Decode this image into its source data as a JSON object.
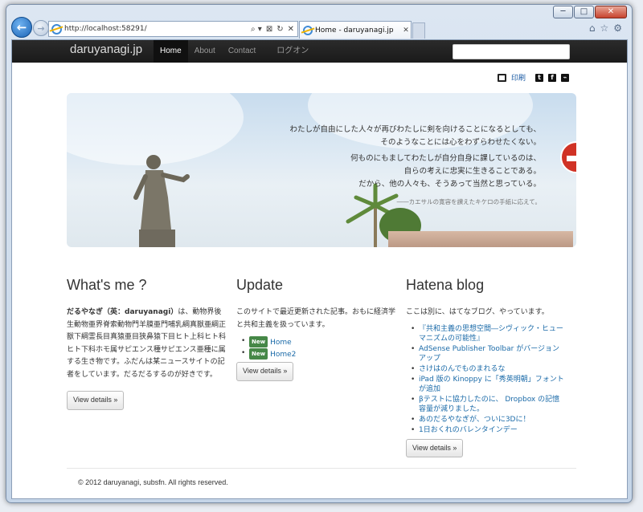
{
  "browser": {
    "address": "http://localhost:58291/",
    "tab_title": "Home - daruyanagi.jp",
    "window_buttons": {
      "minimize": "─",
      "maximize": "□",
      "close": "✕"
    },
    "address_tools": [
      "⌕ ▾",
      "⊠",
      "↻",
      "✕"
    ],
    "right_tools": [
      "⌂",
      "☆",
      "⚙"
    ]
  },
  "navbar": {
    "brand": "daruyanagi.jp",
    "links": [
      {
        "label": "Home",
        "active": true
      },
      {
        "label": "About",
        "active": false
      },
      {
        "label": "Contact",
        "active": false
      },
      {
        "label": "ログオン",
        "active": false
      }
    ],
    "search_placeholder": ""
  },
  "share": {
    "print_label": "印刷",
    "icons": [
      "twitter-icon",
      "facebook-icon",
      "rss-icon"
    ],
    "icon_glyphs": [
      "t",
      "f",
      "⌁"
    ]
  },
  "hero": {
    "quote_lines_1": [
      "わたしが自由にした人々が再びわたしに剣を向けることになるとしても、",
      "そのようなことには心をわずらわせたくない。"
    ],
    "quote_lines_2": [
      "何ものにもましてわたしが自分自身に課しているのは、",
      "自らの考えに忠実に生きることである。",
      "だから、他の人々も、そうあって当然と思っている。"
    ],
    "attribution": "――カエサルの寛容を讃えたキケロの手紙に応えて。"
  },
  "columns": {
    "whats_me": {
      "title": "What's me ?",
      "body_bold": "だるやなぎ（英：daruyanagi）",
      "body": "は、動物界後生動物亜界脊索動物門羊膜亜門哺乳綱真獣亜綱正獣下綱霊長目真猿亜目狭鼻猿下目ヒト上科ヒト科ヒト下科ホモ属サピエンス種サピエンス亜種に属する生き物です。ふだんは某ニュースサイトの記者をしています。だるだるするのが好きです。",
      "button": "View details »"
    },
    "update": {
      "title": "Update",
      "body": "このサイトで最近更新された記事。おもに経済学と共和主義を扱っています。",
      "badge": "New",
      "items": [
        "Home",
        "Home2"
      ],
      "button": "View details »"
    },
    "hatena": {
      "title": "Hatena blog",
      "body": "ここは別に、はてなブログ、やっています。",
      "items": [
        "『共和主義の思想空間―シヴィック・ヒューマニズムの可能性』",
        "AdSense Publisher Toolbar がバージョンアップ",
        "さけはのんでものまれるな",
        "iPad 版の Kinoppy に「秀英明朝」フォントが追加",
        "βテストに協力したのに、 Dropbox の記憶容量が減りました。",
        "あのだるやなぎが、ついに3Dに！",
        "1日おくれのバレンタインデー"
      ],
      "button": "View details »"
    }
  },
  "footer": {
    "text": "© 2012 daruyanagi, subsfn. All rights reserved."
  }
}
